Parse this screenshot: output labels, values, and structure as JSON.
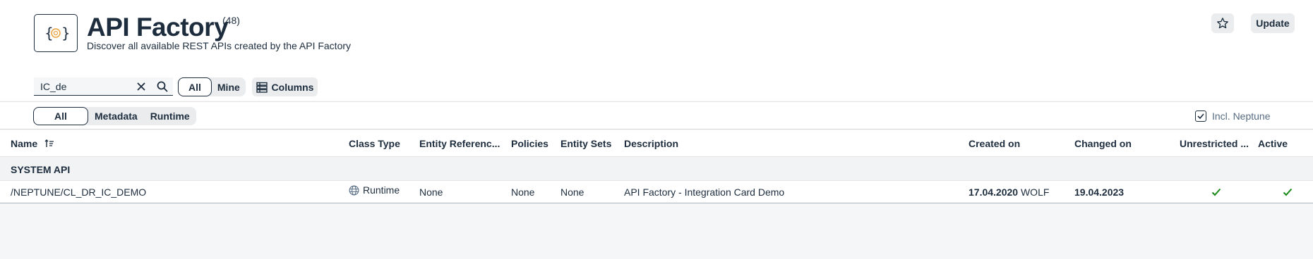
{
  "header": {
    "title": "API Factory",
    "count": "(48)",
    "subtitle": "Discover all available REST APIs created by the API Factory",
    "update_label": "Update"
  },
  "search": {
    "value": "IC_de"
  },
  "filter_owner": {
    "all": "All",
    "mine": "Mine"
  },
  "columns_label": "Columns",
  "filter_type": {
    "all": "All",
    "metadata": "Metadata",
    "runtime": "Runtime"
  },
  "incl_neptune": {
    "label": "Incl. Neptune",
    "checked": true
  },
  "table": {
    "columns": [
      "Name",
      "Class Type",
      "Entity Referenc...",
      "Policies",
      "Entity Sets",
      "Description",
      "Created on",
      "Changed on",
      "Unrestricted ...",
      "Active"
    ],
    "group": "SYSTEM API",
    "rows": [
      {
        "name": "/NEPTUNE/CL_DR_IC_DEMO",
        "class_type": "Runtime",
        "entity_references": "None",
        "policies": "None",
        "entity_sets": "None",
        "description": "API Factory - Integration Card Demo",
        "created_date": "17.04.2020",
        "created_by": "WOLF",
        "changed_date": "19.04.2023",
        "unrestricted": true,
        "active": true
      }
    ]
  },
  "colors": {
    "text": "#1d2d3e",
    "check": "#188918",
    "muted": "#556b82"
  }
}
